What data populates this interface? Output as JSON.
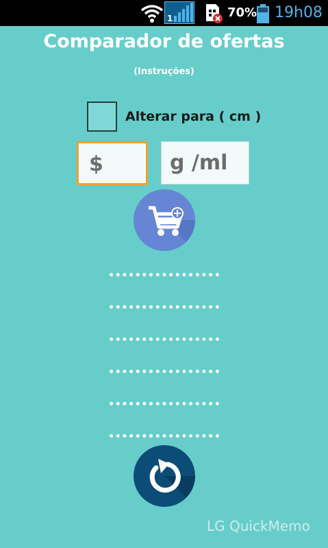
{
  "status_bar": {
    "sim_slot": "1",
    "battery_percent": "70%",
    "time": "19h08",
    "icons": [
      "wifi-icon",
      "signal-icon",
      "sim-error-icon",
      "battery-icon"
    ]
  },
  "app": {
    "title": "Comparador de ofertas",
    "instructions_link": "(Instruções)"
  },
  "form": {
    "unit_toggle_label": "Alterar para ( cm )",
    "unit_toggle_checked": false,
    "price_placeholder": "$",
    "quantity_placeholder": "g /ml",
    "add_button_icon": "cart-add-icon"
  },
  "results": {
    "rows": [
      "................",
      "................",
      "................",
      "................",
      "................",
      "................"
    ]
  },
  "reset_button_icon": "refresh-icon",
  "watermark": "LG QuickMemo",
  "colors": {
    "background": "#67cdca",
    "accent_focus": "#f0a229",
    "cart_button": "#6685d5",
    "reset_button": "#0c4d77",
    "time_text": "#4fb3e8"
  }
}
